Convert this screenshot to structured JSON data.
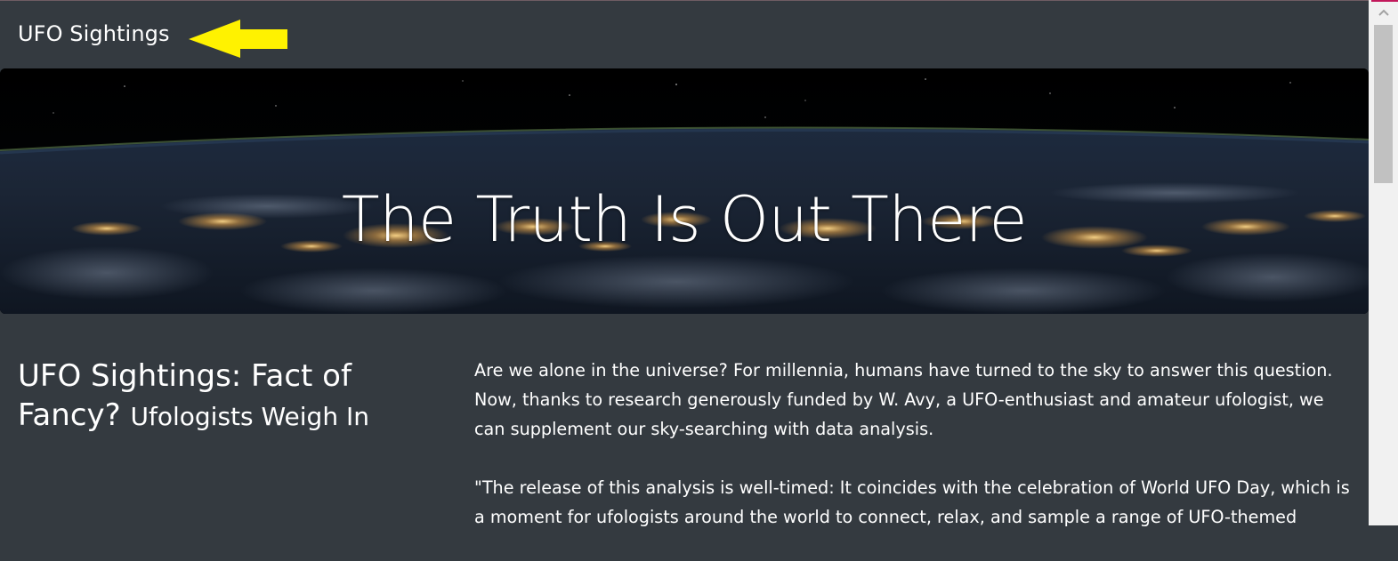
{
  "navbar": {
    "brand": "UFO Sightings",
    "arrow_color": "#fff200"
  },
  "hero": {
    "title": "The Truth Is Out There"
  },
  "article": {
    "headline": "UFO Sightings: Fact of Fancy?",
    "subheadline": "Ufologists Weigh In",
    "paragraphs": [
      "Are we alone in the universe? For millennia, humans have turned to the sky to answer this question. Now, thanks to research generously funded by W. Avy, a UFO-enthusiast and amateur ufologist, we can supplement our sky-searching with data analysis.",
      "\"The release of this analysis is well-timed: It coincides with the celebration of World UFO Day, which is a moment for ufologists around the world to connect, relax, and sample a range of UFO-themed"
    ]
  },
  "colors": {
    "background": "#343a40",
    "text": "#ffffff",
    "scrollbar_track": "#f1f1f1",
    "scrollbar_thumb": "#c1c1c1"
  }
}
